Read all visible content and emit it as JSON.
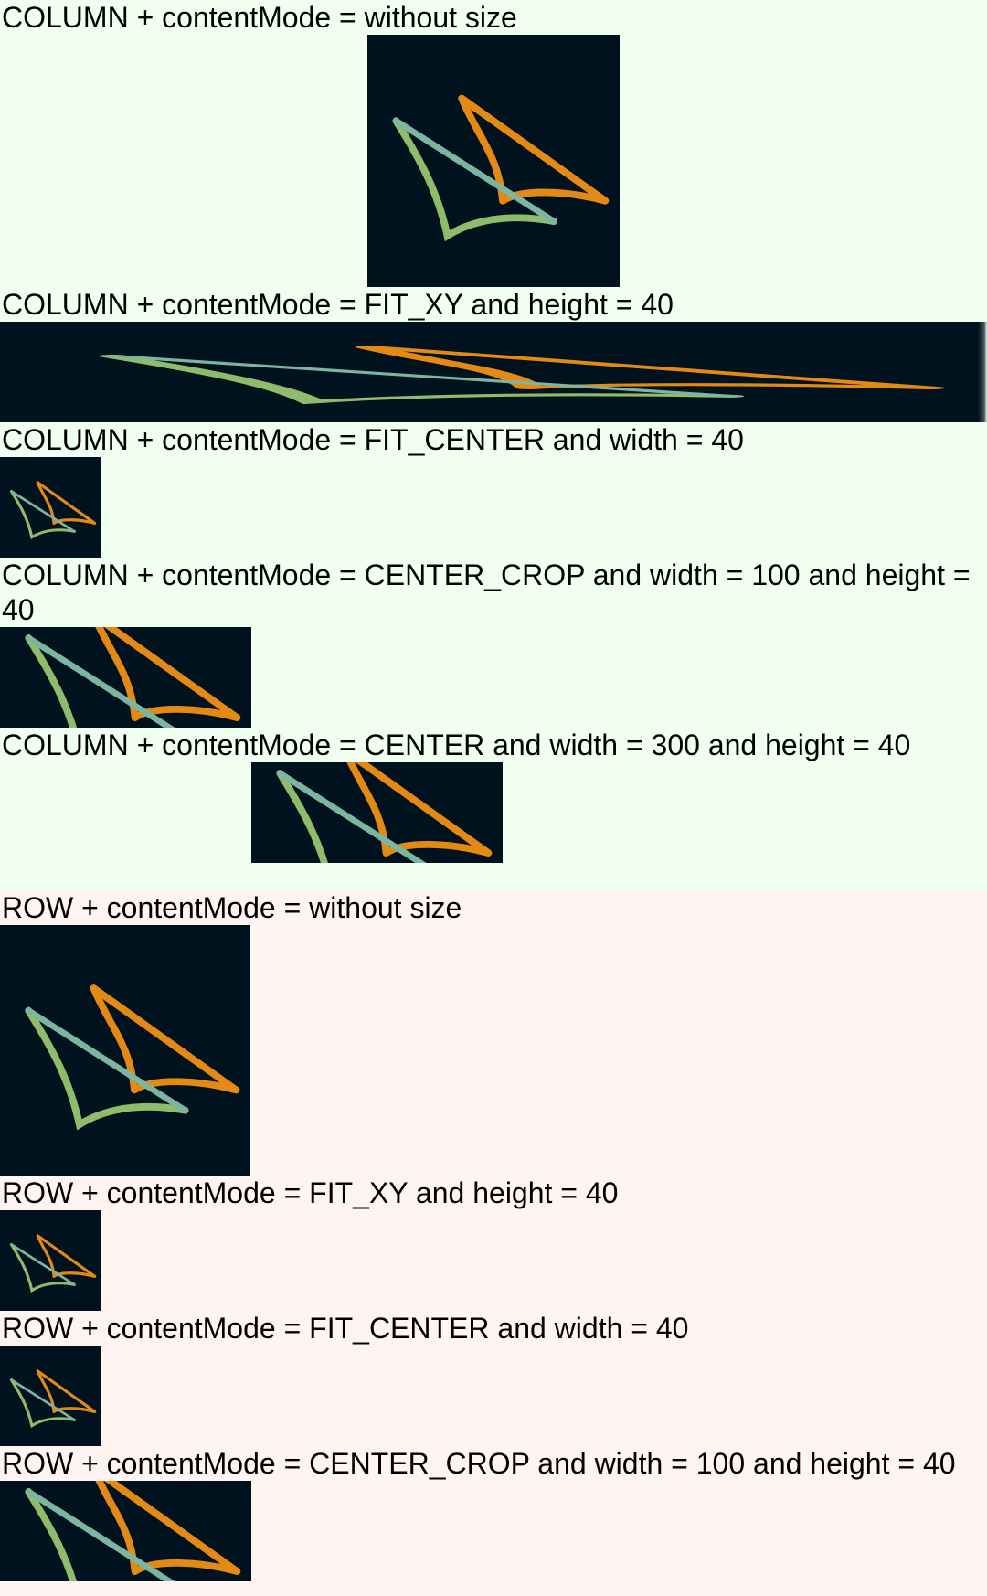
{
  "colors": {
    "column_bg": "#f1fff1",
    "row_bg": "#fff4f1",
    "image_bg": "#00121e",
    "stroke_orange": "#e48a14",
    "stroke_green": "#8fbc6a",
    "stroke_teal": "#7cb6a0"
  },
  "column": {
    "items": [
      {
        "label": "COLUMN + contentMode = without size"
      },
      {
        "label": "COLUMN + contentMode = FIT_XY and height = 40"
      },
      {
        "label": "COLUMN + contentMode = FIT_CENTER and width = 40"
      },
      {
        "label": "COLUMN + contentMode = CENTER_CROP and width = 100 and height = 40"
      },
      {
        "label": "COLUMN + contentMode = CENTER and width = 300 and height = 40"
      }
    ]
  },
  "row": {
    "items": [
      {
        "label": "ROW + contentMode = without size"
      },
      {
        "label": "ROW + contentMode = FIT_XY and height = 40"
      },
      {
        "label": "ROW + contentMode = FIT_CENTER and width = 40"
      },
      {
        "label": "ROW + contentMode = CENTER_CROP and width = 100 and height = 40"
      }
    ]
  },
  "image": {
    "icon": "sail-logo-icon"
  }
}
